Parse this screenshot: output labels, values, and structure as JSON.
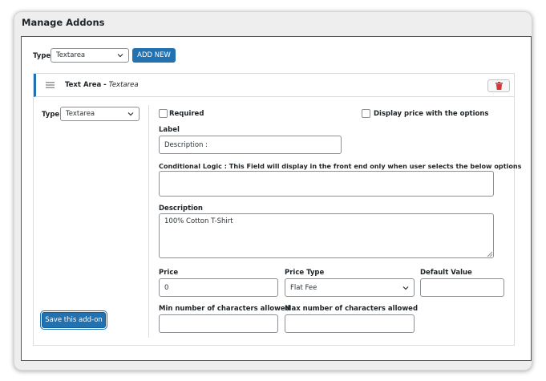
{
  "panel": {
    "title": "Manage Addons"
  },
  "toolbar": {
    "type_label": "Type",
    "type_value": "Textarea",
    "add_new_label": "ADD NEW"
  },
  "addon": {
    "name": "Text Area",
    "separator": " - ",
    "type_name": "Textarea",
    "type_label": "Type",
    "type_value": "Textarea",
    "required_label": "Required",
    "display_price_label": "Display price with the options",
    "label_heading": "Label",
    "label_value": "Description :",
    "conditional_heading": "Conditional Logic : This Field will display in the front end only when user selects the below options",
    "conditional_value": "",
    "description_heading": "Description",
    "description_value": "100% Cotton T-Shirt",
    "price_heading": "Price",
    "price_value": "0",
    "price_type_heading": "Price Type",
    "price_type_value": "Flat Fee",
    "default_value_heading": "Default Value",
    "default_value": "",
    "min_chars_heading": "Min number of characters allowed",
    "min_chars_value": "",
    "max_chars_heading": "Max number of characters allowed",
    "max_chars_value": "",
    "save_label": "Save this add-on"
  },
  "icons": {
    "drag": "drag-handle-icon",
    "delete": "trash-icon",
    "dropdown": "chevron-down-icon"
  },
  "colors": {
    "accent": "#2271b1",
    "delete": "#d63638"
  }
}
